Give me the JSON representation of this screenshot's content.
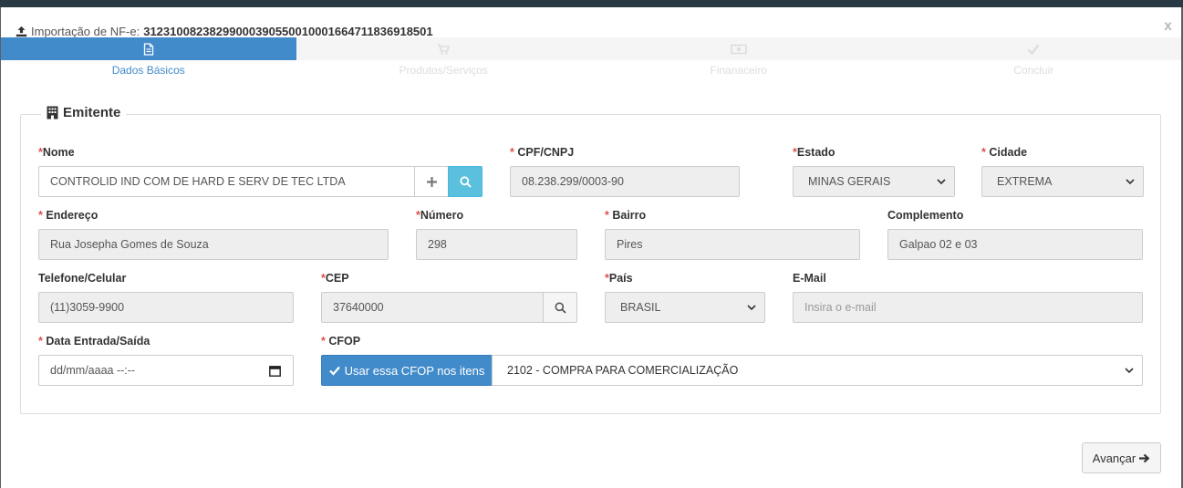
{
  "modal": {
    "title_label": "Importação de NF-e:",
    "title_key": "31231008238299000390550010001664711836918501",
    "close_label": "x"
  },
  "steps": [
    {
      "label": "Dados Básicos",
      "icon": "document-icon",
      "active": true
    },
    {
      "label": "Produtos/Serviços",
      "icon": "cart-icon",
      "active": false
    },
    {
      "label": "Finanaceiro",
      "icon": "money-icon",
      "active": false
    },
    {
      "label": "Concluir",
      "icon": "check-icon",
      "active": false
    }
  ],
  "emitente": {
    "legend": "Emitente",
    "nome": {
      "label": "Nome",
      "value": "CONTROLID IND COM DE HARD E SERV DE TEC LTDA"
    },
    "cpf_cnpj": {
      "label": "CPF/CNPJ",
      "value": "08.238.299/0003-90"
    },
    "estado": {
      "label": "Estado",
      "value": "MINAS GERAIS"
    },
    "cidade": {
      "label": "Cidade",
      "value": "EXTREMA"
    },
    "endereco": {
      "label": "Endereço",
      "value": "Rua Josepha Gomes de Souza"
    },
    "numero": {
      "label": "Número",
      "value": "298"
    },
    "bairro": {
      "label": "Bairro",
      "value": "Pires"
    },
    "complemento": {
      "label": "Complemento",
      "value": "Galpao 02 e 03"
    },
    "telefone": {
      "label": "Telefone/Celular",
      "value": "(11)3059-9900"
    },
    "cep": {
      "label": "CEP",
      "value": "37640000"
    },
    "pais": {
      "label": "País",
      "value": "BRASIL"
    },
    "email": {
      "label": "E-Mail",
      "placeholder": "Insira o e-mail"
    },
    "data": {
      "label": "Data Entrada/Saída",
      "placeholder": "dd/mm/aaaa --:--"
    },
    "cfop": {
      "label": "CFOP",
      "button_label": "Usar essa CFOP nos itens",
      "value": "2102 - COMPRA PARA COMERCIALIZAÇÃO"
    }
  },
  "required_marker": "*",
  "footer": {
    "next_label": "Avançar"
  },
  "colors": {
    "primary": "#428bca",
    "info": "#5bc0de",
    "required": "#d9534f"
  }
}
